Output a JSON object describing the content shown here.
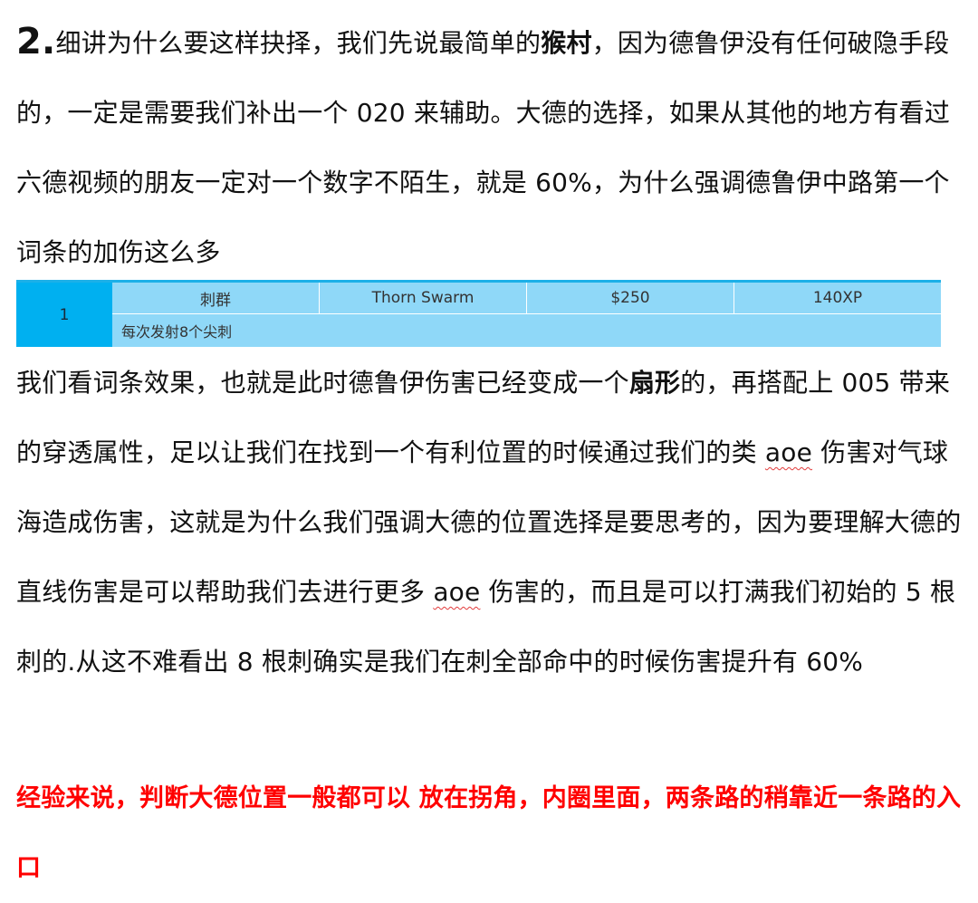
{
  "para1": {
    "num": "2.",
    "t1": "细讲为什么要这样抉择，我们先说最简单的",
    "b1": "猴村",
    "t2": "，因为德鲁伊没有任何破隐手段的，一定是需要我们补出一个 020 来辅助。大德的选择，如果从其他的地方有看过六德视频的朋友一定对一个数字不陌生，就是 60%，为什么强调德鲁伊中路第一个词条的加伤这么多"
  },
  "table": {
    "index": "1",
    "cells": [
      "刺群",
      "Thorn Swarm",
      "$250",
      "140XP"
    ],
    "description": "每次发射8个尖刺"
  },
  "para2": {
    "t1": "我们看词条效果，也就是此时德鲁伊伤害已经变成一个",
    "b1": "扇形",
    "t2": "的，再搭配上 005 带来的穿透属性，足以让我们在找到一个有利位置的时候通过我们的类 ",
    "w1": "aoe",
    "t3": " 伤害对气球海造成伤害，这就是为什么我们强调大德的位置选择是要思考的，因为要理解大德的直线伤害是可以帮助我们去进行更多 ",
    "w2": "aoe",
    "t4": " 伤害的，而且是可以打满我们初始的 5 根刺的.从这不难看出 8 根刺确实是我们在刺全部命中的时候伤害提升有 60%"
  },
  "para3": {
    "text": "经验来说，判断大德位置一般都可以 放在拐角，内圈里面，两条路的稍靠近一条路的入口"
  },
  "colors": {
    "table_accent": "#00b0f0",
    "table_fill": "#8fd8f8",
    "highlight_text": "#ff0000"
  }
}
